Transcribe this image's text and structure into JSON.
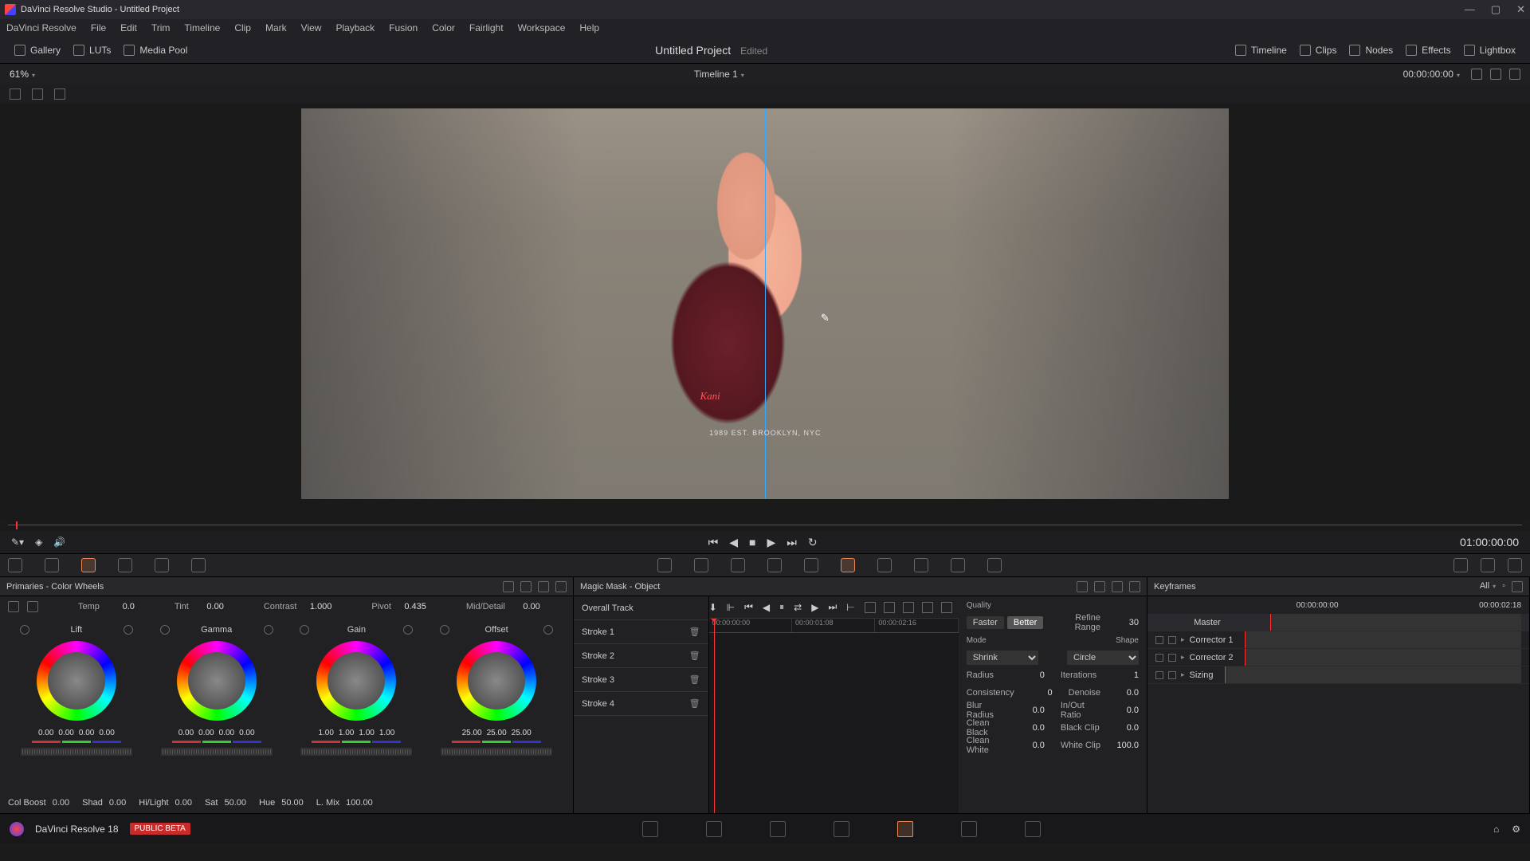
{
  "window": {
    "title": "DaVinci Resolve Studio - Untitled Project"
  },
  "menu": [
    "DaVinci Resolve",
    "File",
    "Edit",
    "Trim",
    "Timeline",
    "Clip",
    "Mark",
    "View",
    "Playback",
    "Fusion",
    "Color",
    "Fairlight",
    "Workspace",
    "Help"
  ],
  "top_tabs": {
    "left": [
      "Gallery",
      "LUTs",
      "Media Pool"
    ],
    "project": "Untitled Project",
    "edited": "Edited",
    "right": [
      "Timeline",
      "Clips",
      "Nodes",
      "Effects",
      "Lightbox"
    ]
  },
  "viewer": {
    "zoom": "61%",
    "timeline_name": "Timeline 1",
    "tc": "00:00:00:00",
    "shirt_graphic": "Kani",
    "shirt_text": "1989 EST. BROOKLYN, NYC"
  },
  "transport_tc": "01:00:00:00",
  "primaries": {
    "title": "Primaries - Color Wheels",
    "row": {
      "temp_l": "Temp",
      "temp_v": "0.0",
      "tint_l": "Tint",
      "tint_v": "0.00",
      "contrast_l": "Contrast",
      "contrast_v": "1.000",
      "pivot_l": "Pivot",
      "pivot_v": "0.435",
      "md_l": "Mid/Detail",
      "md_v": "0.00"
    },
    "wheels": [
      {
        "name": "Lift",
        "vals": [
          "0.00",
          "0.00",
          "0.00",
          "0.00"
        ]
      },
      {
        "name": "Gamma",
        "vals": [
          "0.00",
          "0.00",
          "0.00",
          "0.00"
        ]
      },
      {
        "name": "Gain",
        "vals": [
          "1.00",
          "1.00",
          "1.00",
          "1.00"
        ]
      },
      {
        "name": "Offset",
        "vals": [
          "25.00",
          "25.00",
          "25.00"
        ]
      }
    ],
    "bottom": {
      "cb_l": "Col Boost",
      "cb_v": "0.00",
      "sh_l": "Shad",
      "sh_v": "0.00",
      "hl_l": "Hi/Light",
      "hl_v": "0.00",
      "sat_l": "Sat",
      "sat_v": "50.00",
      "hue_l": "Hue",
      "hue_v": "50.00",
      "lm_l": "L. Mix",
      "lm_v": "100.00"
    }
  },
  "magicmask": {
    "title": "Magic Mask - Object",
    "tracks": [
      "Overall Track",
      "Stroke 1",
      "Stroke 2",
      "Stroke 3",
      "Stroke 4"
    ],
    "ruler": [
      "00:00:00:00",
      "00:00:01:08",
      "00:00:02:16"
    ],
    "quality": {
      "label": "Quality",
      "opts": [
        "Faster",
        "Better"
      ],
      "active": "Better"
    },
    "refine": {
      "label": "Refine Range",
      "val": "30"
    },
    "mode": {
      "label": "Mode",
      "val": "Shrink"
    },
    "shape": {
      "label": "Shape",
      "val": "Circle"
    },
    "props": [
      {
        "l": "Radius",
        "v": "0"
      },
      {
        "l": "Iterations",
        "v": "1"
      },
      {
        "l": "Consistency",
        "v": "0"
      },
      {
        "l": "Denoise",
        "v": "0.0"
      },
      {
        "l": "Blur Radius",
        "v": "0.0"
      },
      {
        "l": "In/Out Ratio",
        "v": "0.0"
      },
      {
        "l": "Clean Black",
        "v": "0.0"
      },
      {
        "l": "Black Clip",
        "v": "0.0"
      },
      {
        "l": "Clean White",
        "v": "0.0"
      },
      {
        "l": "White Clip",
        "v": "100.0"
      }
    ]
  },
  "keyframes": {
    "title": "Keyframes",
    "filter": "All",
    "tc": "00:00:00:00",
    "end_tc": "00:00:02:18",
    "master": "Master",
    "rows": [
      "Corrector 1",
      "Corrector 2",
      "Sizing"
    ]
  },
  "footer": {
    "name": "DaVinci Resolve 18",
    "badge": "PUBLIC BETA"
  }
}
